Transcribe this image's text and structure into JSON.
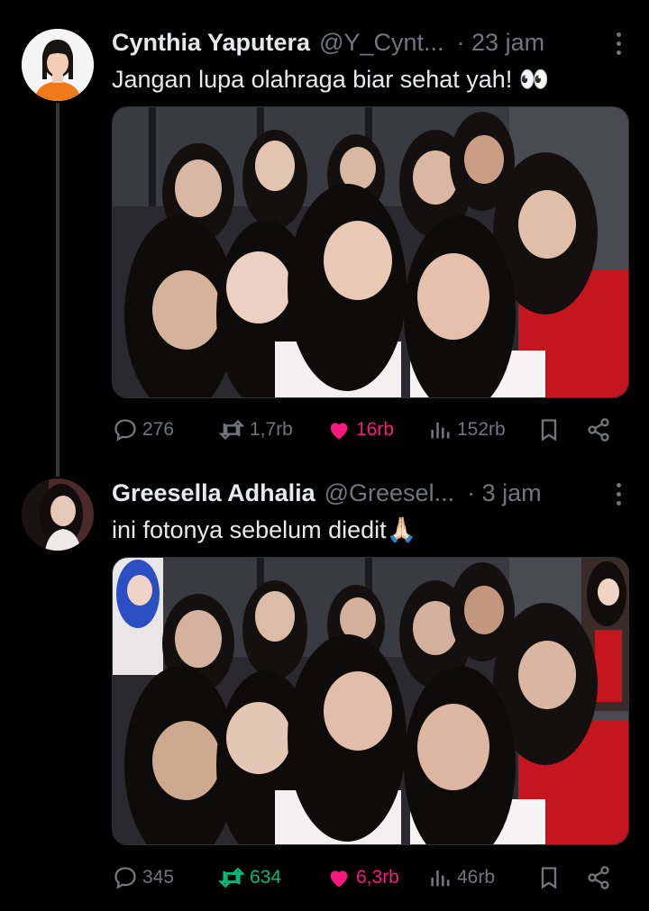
{
  "tweets": [
    {
      "name": "Cynthia Yaputera",
      "handle": "@Y_Cynt...",
      "time": "· 23 jam",
      "text": "Jangan lupa olahraga biar sehat yah! 👀",
      "replies": "276",
      "retweets": "1,7rb",
      "likes": "16rb",
      "views": "152rb",
      "liked": true,
      "retweeted": false
    },
    {
      "name": "Greesella Adhalia",
      "handle": "@Greesel...",
      "time": "· 3 jam",
      "text": "ini fotonya sebelum diedit🙏🏻",
      "replies": "345",
      "retweets": "634",
      "likes": "6,3rb",
      "views": "46rb",
      "liked": true,
      "retweeted": true
    }
  ],
  "icons": {
    "reply": "reply-icon",
    "retweet": "retweet-icon",
    "like": "heart-icon",
    "views": "views-icon",
    "bookmark": "bookmark-icon",
    "share": "share-icon",
    "more": "more-options-icon"
  },
  "colors": {
    "background": "#000000",
    "text": "#e7e9ea",
    "muted": "#71767b",
    "like": "#f91880",
    "retweet": "#00ba7c"
  }
}
